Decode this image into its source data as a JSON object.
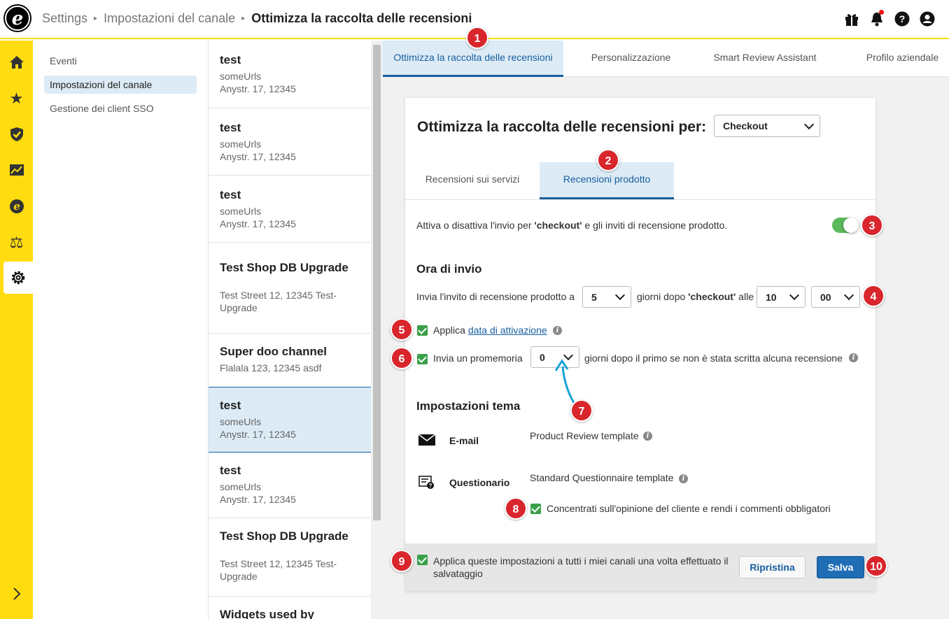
{
  "breadcrumb": {
    "items": [
      "Settings",
      "Impostazioni del canale"
    ],
    "current": "Ottimizza la raccolta delle recensioni"
  },
  "subnav": {
    "items": [
      "Eventi",
      "Impostazioni del canale",
      "Gestione dei client SSO"
    ],
    "selected": "Impostazioni del canale"
  },
  "channels": [
    {
      "name": "test",
      "url": "someUrls",
      "address": "Anystr. 17, 12345"
    },
    {
      "name": "test",
      "url": "someUrls",
      "address": "Anystr. 17, 12345"
    },
    {
      "name": "test",
      "url": "someUrls",
      "address": "Anystr. 17, 12345"
    },
    {
      "name": "Test Shop DB Upgrade",
      "url": "",
      "address": "Test Street 12, 12345 Test-Upgrade"
    },
    {
      "name": "Super doo channel",
      "url": "",
      "address": "Flalala 123, 12345 asdf"
    },
    {
      "name": "test",
      "url": "someUrls",
      "address": "Anystr. 17, 12345"
    },
    {
      "name": "test",
      "url": "someUrls",
      "address": "Anystr. 17, 12345"
    },
    {
      "name": "Test Shop DB Upgrade",
      "url": "",
      "address": "Test Street 12, 12345 Test-Upgrade"
    },
    {
      "name": "Widgets used by",
      "url": "",
      "address": ""
    }
  ],
  "tabs": [
    "Ottimizza la raccolta delle recensioni",
    "Personalizzazione",
    "Smart Review Assistant",
    "Profilo aziendale"
  ],
  "card": {
    "title": "Ottimizza la raccolta delle recensioni per:",
    "event_select": "Checkout",
    "subtabs": [
      "Recensioni sui servizi",
      "Recensioni prodotto"
    ],
    "toggle_text_pre": "Attiva o disattiva l'invio per ",
    "toggle_text_bold": "'checkout'",
    "toggle_text_post": " e gli inviti di recensione prodotto.",
    "toggle_on": true,
    "send_time_heading": "Ora di invio",
    "send_pre": "Invia l'invito di recensione prodotto a",
    "days_value": "5",
    "send_mid_pre": "giorni dopo ",
    "send_mid_bold": "'checkout'",
    "send_mid_post": " alle",
    "hour_value": "10",
    "minute_value": "00",
    "apply_label": "Applica ",
    "apply_link": "data di attivazione",
    "reminder_label": "Invia un promemoria",
    "reminder_value": "0",
    "reminder_post": "giorni dopo il primo se non è stata scritta alcuna recensione",
    "theme_heading": "Impostazioni tema",
    "email_label": "E-mail",
    "email_template": "Product Review template",
    "questionnaire_label": "Questionario",
    "questionnaire_template": "Standard Questionnaire template",
    "focus_label": "Concentrati sull'opinione del cliente e rendi i commenti obbligatori",
    "apply_all_label": "Applica queste impostazioni a tutti i miei canali una volta effettuato il salvataggio",
    "reset_button": "Ripristina",
    "save_button": "Salva"
  },
  "badges": [
    "1",
    "2",
    "3",
    "4",
    "5",
    "6",
    "7",
    "8",
    "9",
    "10"
  ],
  "colors": {
    "brand_yellow": "#ffdc0f",
    "accent_blue": "#1a5fa0",
    "badge_red": "#d9252c",
    "check_green": "#3aa04a"
  }
}
